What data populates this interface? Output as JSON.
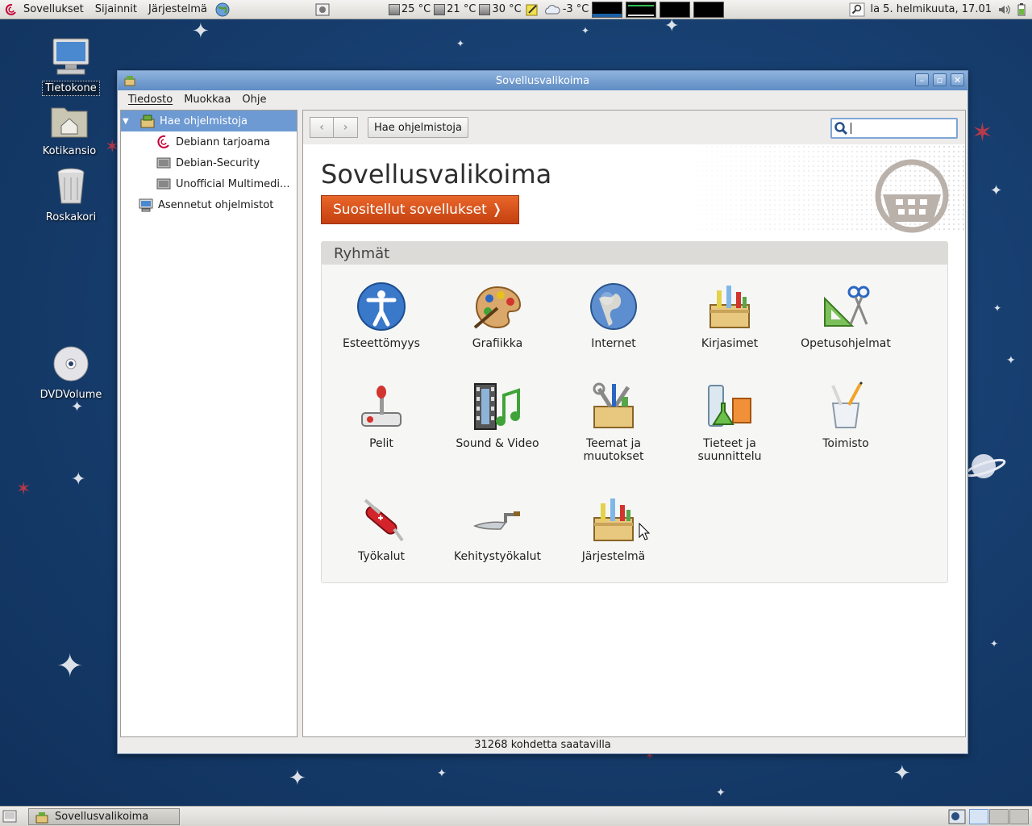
{
  "top_panel": {
    "menus": [
      "Sovellukset",
      "Sijainnit",
      "Järjestelmä"
    ],
    "sensors": [
      "25 °C",
      "21 °C",
      "30 °C"
    ],
    "weather": "-3 °C",
    "clock": "la  5. helmikuuta, 17.01"
  },
  "desktop": {
    "icons": [
      "Tietokone",
      "Kotikansio",
      "Roskakori",
      "DVDVolume"
    ]
  },
  "window": {
    "title": "Sovellusvalikoima",
    "menubar": [
      "Tiedosto",
      "Muokkaa",
      "Ohje"
    ],
    "sidebar": [
      {
        "label": "Hae ohjelmistoja",
        "selected": true
      },
      {
        "label": "Debiann tarjoama"
      },
      {
        "label": "Debian-Security"
      },
      {
        "label": "Unofficial Multimedi..."
      },
      {
        "label": "Asennetut ohjelmistot"
      }
    ],
    "toolbar": {
      "back": "‹",
      "forward": "›",
      "crumb": "Hae ohjelmistoja",
      "search_value": ""
    },
    "hero_title": "Sovellusvalikoima",
    "featured_button": "Suositellut sovellukset ❭",
    "groups_title": "Ryhmät",
    "categories": [
      "Esteettömyys",
      "Grafiikka",
      "Internet",
      "Kirjasimet",
      "Opetusohjelmat",
      "Pelit",
      "Sound & Video",
      "Teemat ja muutokset",
      "Tieteet ja suunnittelu",
      "Toimisto",
      "Työkalut",
      "Kehitystyökalut",
      "Järjestelmä"
    ],
    "status": "31268 kohdetta saatavilla"
  },
  "bottom_panel": {
    "task": "Sovellusvalikoima"
  },
  "colors": {
    "accent": "#6d9ad2",
    "featured": "#d9541c",
    "desktop": "#173f70"
  }
}
